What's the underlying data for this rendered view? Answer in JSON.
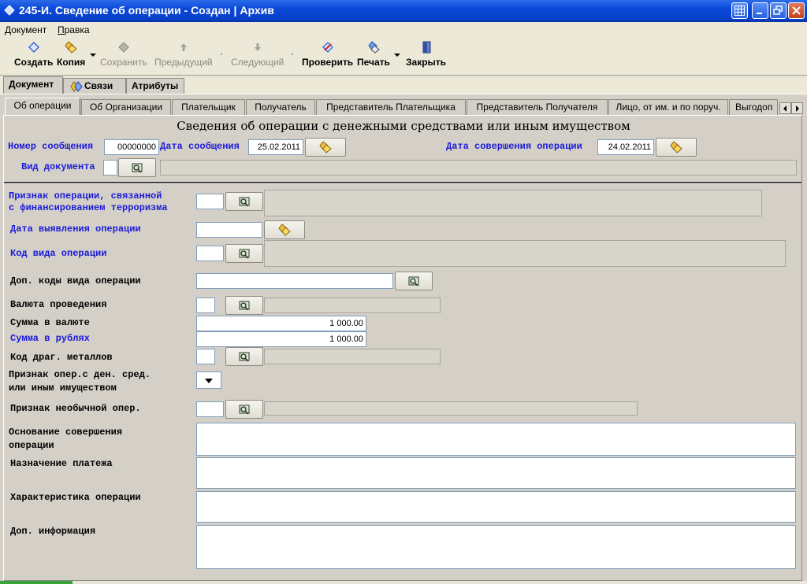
{
  "window": {
    "title": "245-И. Сведение  об операции - Создан | Архив"
  },
  "menu": [
    "Документ",
    "Правка"
  ],
  "toolbar": {
    "create": "Создать",
    "copy": "Копия",
    "save": "Сохранить",
    "prev": "Предыдущий",
    "next": "Следующий",
    "check": "Проверить",
    "print": "Печать",
    "close": "Закрыть"
  },
  "top_tabs": [
    "Документ",
    "Связи",
    "Атрибуты"
  ],
  "sub_tabs": [
    "Об операции",
    "Об Организации",
    "Плательщик",
    "Получатель",
    "Представитель Плательщика",
    "Представитель Получателя",
    "Лицо, от им. и по поруч.",
    "Выгодоп"
  ],
  "form": {
    "title": "Сведения об операции с денежными средствами или иным имуществом",
    "msg_number_label": "Номер сообщения",
    "msg_number_value": "00000000",
    "msg_date_label": "Дата сообщения",
    "msg_date_value": "25.02.2011",
    "op_date_label": "Дата совершения операции",
    "op_date_value": "24.02.2011",
    "doc_type_label": "Вид документа",
    "terror_label_1": "Признак операции, связанной",
    "terror_label_2": "с финансированием терроризма",
    "detect_date_label": "Дата выявления операции",
    "op_code_label": "Код вида операции",
    "extra_codes_label": "Доп. коды вида операции",
    "currency_label": "Валюта проведения",
    "amount_currency_label": "Сумма в валюте",
    "amount_currency_value": "1 000.00",
    "amount_rub_label": "Сумма в рублях",
    "amount_rub_value": "1 000.00",
    "metals_label": "Код драг. металлов",
    "op_sign_label_1": "Признак опер.с ден. сред.",
    "op_sign_label_2": "или иным имуществом",
    "unusual_label": "Признак необычной опер.",
    "basis_label_1": "Основание совершения",
    "basis_label_2": "операции",
    "purpose_label": "Назначение платежа",
    "characteristic_label": "Характеристика операции",
    "extra_info_label": "Доп. информация"
  },
  "colors": {
    "titlebar": "#0a48d8",
    "required_label": "#1a1ad8",
    "panel": "#d4d0c8"
  }
}
